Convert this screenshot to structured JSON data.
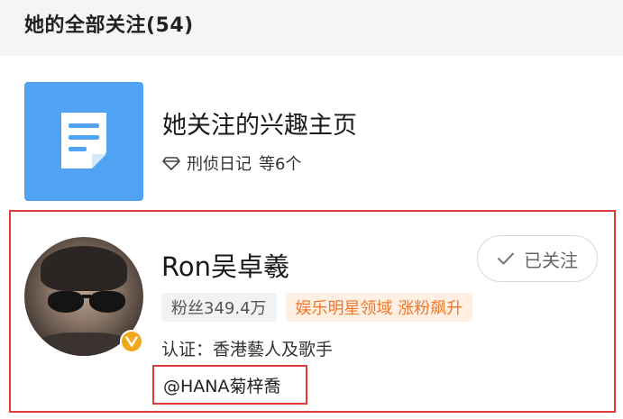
{
  "section": {
    "title": "她的全部关注(54)"
  },
  "interest": {
    "title": "她关注的兴趣主页",
    "topic": "刑侦日记",
    "more": "等6个",
    "tile_color": "#4fa3f2",
    "icon": "document-icon",
    "sub_icon": "diamond-icon"
  },
  "user": {
    "name": "Ron吴卓羲",
    "follow_label": "已关注",
    "fans_tag": "粉丝349.4万",
    "hot_tag": "娱乐明星领域 涨粉飙升",
    "verification": "认证：香港藝人及歌手",
    "mention": "@HANA菊梓喬",
    "badge_color": "#f2a81d",
    "highlight_color": "#e03a3a",
    "hot_tag_color": "#f0782b"
  }
}
